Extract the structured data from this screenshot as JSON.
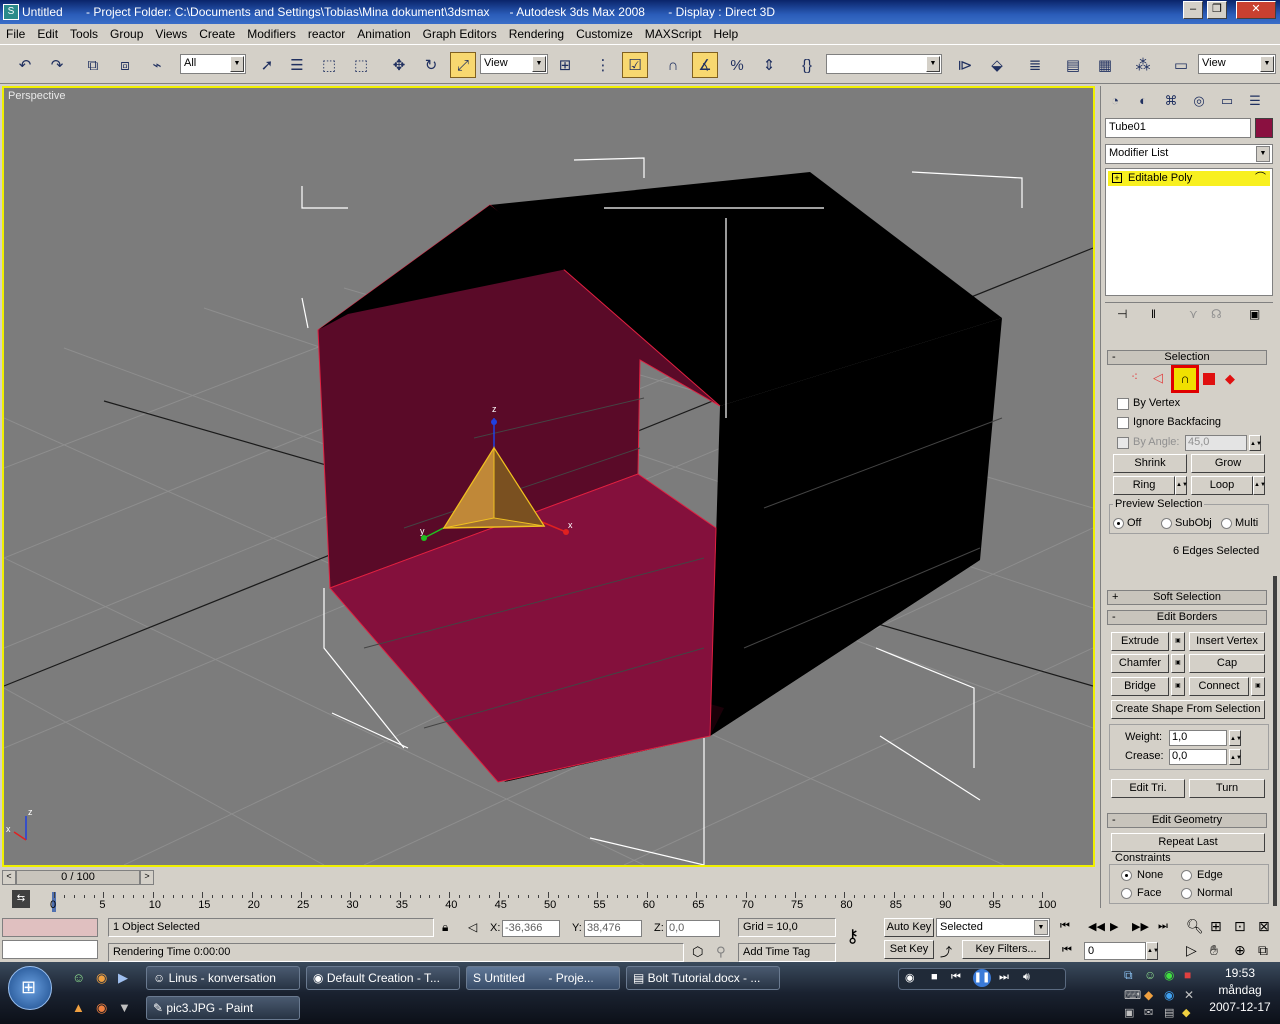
{
  "window": {
    "title": "Untitled       - Project Folder: C:\\Documents and Settings\\Tobias\\Mina dokument\\3dsmax      - Autodesk 3ds Max 2008       - Display : Direct 3D"
  },
  "menu": [
    "File",
    "Edit",
    "Tools",
    "Group",
    "Views",
    "Create",
    "Modifiers",
    "reactor",
    "Animation",
    "Graph Editors",
    "Rendering",
    "Customize",
    "MAXScript",
    "Help"
  ],
  "toolbar": {
    "selection_filter": "All",
    "reference_coord": "View",
    "named_selection": "",
    "view_select": "View"
  },
  "viewport": {
    "label": "Perspective",
    "gizmo_axes": {
      "x": "x",
      "y": "y",
      "z": "z"
    },
    "corner_axes": {
      "x": "x",
      "z": "z"
    }
  },
  "command_panel": {
    "object_name": "Tube01",
    "object_color": "#8a1040",
    "modifier_list": "Modifier List",
    "stack_item": "Editable Poly",
    "selection": {
      "title": "Selection",
      "by_vertex": "By Vertex",
      "ignore_backfacing": "Ignore Backfacing",
      "by_angle": "By Angle:",
      "by_angle_value": "45,0",
      "shrink": "Shrink",
      "grow": "Grow",
      "ring": "Ring",
      "loop": "Loop",
      "preview_selection": "Preview Selection",
      "preview_off": "Off",
      "preview_subobj": "SubObj",
      "preview_multi": "Multi",
      "status": "6 Edges Selected"
    },
    "soft_selection": "Soft Selection",
    "edit_borders": {
      "title": "Edit Borders",
      "extrude": "Extrude",
      "insert_vertex": "Insert Vertex",
      "chamfer": "Chamfer",
      "cap": "Cap",
      "bridge": "Bridge",
      "connect": "Connect",
      "create_shape": "Create Shape From Selection",
      "weight_label": "Weight:",
      "weight_value": "1,0",
      "crease_label": "Crease:",
      "crease_value": "0,0",
      "edit_tri": "Edit Tri.",
      "turn": "Turn"
    },
    "edit_geometry": {
      "title": "Edit Geometry",
      "repeat_last": "Repeat Last",
      "constraints": "Constraints",
      "none": "None",
      "edge": "Edge",
      "face": "Face",
      "normal": "Normal"
    }
  },
  "timeline": {
    "slider_label": "0 / 100",
    "ticks": [
      "0",
      "5",
      "10",
      "15",
      "20",
      "25",
      "30",
      "35",
      "40",
      "45",
      "50",
      "55",
      "60",
      "65",
      "70",
      "75",
      "80",
      "85",
      "90",
      "95",
      "100"
    ]
  },
  "status": {
    "selected": "1 Object Selected",
    "rendering_time": "Rendering Time  0:00:00",
    "x_label": "X:",
    "x_value": "-36,366",
    "y_label": "Y:",
    "y_value": "38,476",
    "z_label": "Z:",
    "z_value": "0,0",
    "grid": "Grid = 10,0",
    "add_time_tag": "Add Time Tag",
    "auto_key": "Auto Key",
    "set_key": "Set Key",
    "key_mode": "Selected",
    "key_filters": "Key Filters...",
    "frame": "0"
  },
  "taskbar": {
    "tasks_row1": [
      "Linus - konversation",
      "Default Creation - T...",
      "Untitled       - Proje...",
      "Bolt Tutorial.docx - ..."
    ],
    "tasks_row2": [
      "pic3.JPG - Paint"
    ],
    "clock_time": "19:53",
    "clock_day": "måndag",
    "clock_date": "2007-12-17"
  }
}
